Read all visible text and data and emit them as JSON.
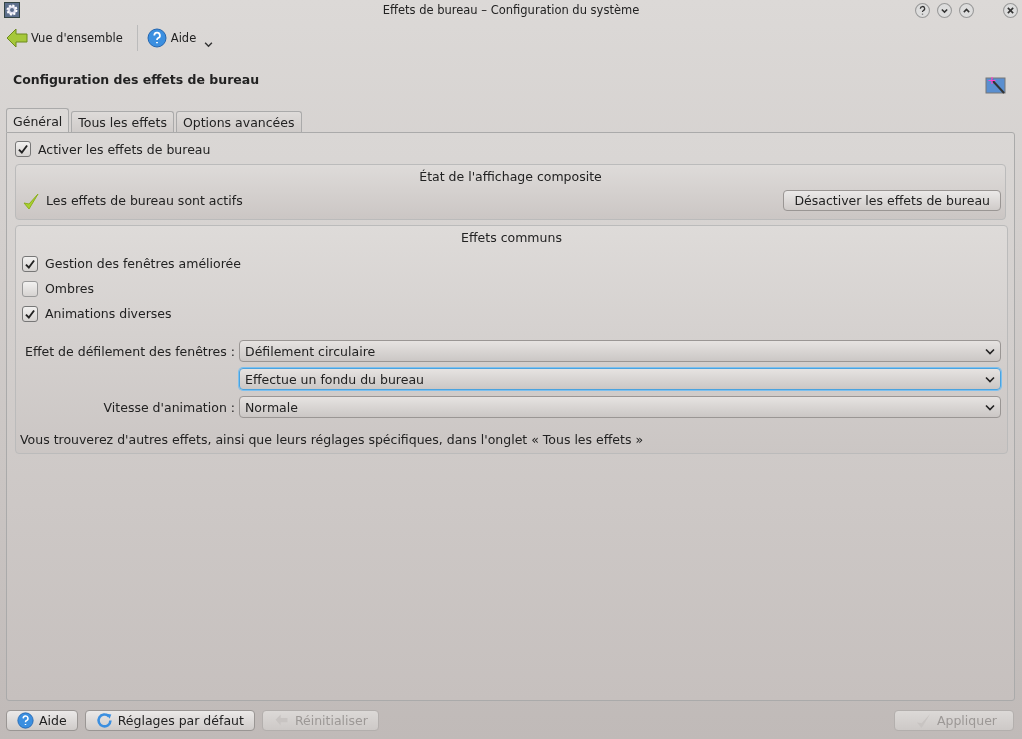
{
  "window": {
    "title": "Effets de bureau – Configuration du système"
  },
  "toolbar": {
    "items": [
      {
        "kind": "back",
        "label": "Vue d'ensemble"
      },
      {
        "kind": "help",
        "label": "Aide"
      }
    ]
  },
  "heading": "Configuration des effets de bureau",
  "tabs": [
    {
      "label": "Général",
      "selected": true
    },
    {
      "label": "Tous les effets",
      "selected": false
    },
    {
      "label": "Options avancées",
      "selected": false
    }
  ],
  "enable": {
    "label": "Activer les effets de bureau",
    "checked": true
  },
  "composite": {
    "title": "État de l'affichage composite",
    "status": "Les effets de bureau sont actifs",
    "button": "Désactiver les effets de bureau"
  },
  "common": {
    "title": "Effets communs",
    "checks": [
      {
        "label": "Gestion des fenêtres améliorée",
        "checked": true
      },
      {
        "label": "Ombres",
        "checked": false
      },
      {
        "label": "Animations diverses",
        "checked": true
      }
    ],
    "combos": [
      {
        "label": "Effet de défilement des fenêtres :",
        "value": "Défilement circulaire",
        "focused": false
      },
      {
        "value": "Effectue un fondu du bureau",
        "focused": true
      },
      {
        "label": "Vitesse d'animation :",
        "value": "Normale",
        "focused": false
      }
    ],
    "note": "Vous trouverez d'autres effets, ainsi que leurs réglages spécifiques, dans l'onglet « Tous les effets »"
  },
  "buttons": [
    {
      "kind": "help",
      "label": "Aide",
      "disabled": false
    },
    {
      "kind": "defaults",
      "label": "Réglages par défaut",
      "disabled": false
    },
    {
      "kind": "reset",
      "label": "Réinitialiser",
      "disabled": true
    },
    {
      "kind": "apply",
      "label": "Appliquer",
      "disabled": true
    }
  ]
}
